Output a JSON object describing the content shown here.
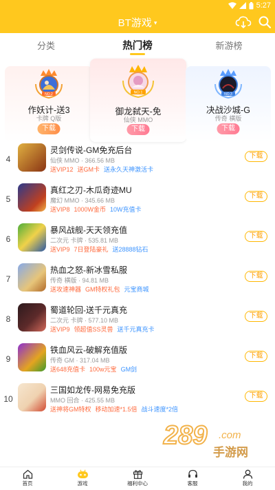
{
  "status_bar": {
    "time": "5:27"
  },
  "header": {
    "title": "BT游戏",
    "title_icon": "chevron-down-icon",
    "bg_color": "#ffc81e"
  },
  "tabs": [
    {
      "label": "分类",
      "active": false
    },
    {
      "label": "热门榜",
      "active": true
    },
    {
      "label": "新游榜",
      "active": false
    }
  ],
  "podium": [
    {
      "place": "left",
      "crown_label": "NO.2",
      "name": "作妖计-送3",
      "tag": "卡牌 Q版",
      "button": "下载",
      "crown_icon": "crown-icon"
    },
    {
      "place": "center",
      "crown_label": "NO.1",
      "name": "御龙弑天-免",
      "tag": "仙侠 MMO",
      "button": "下载",
      "crown_icon": "crown-icon"
    },
    {
      "place": "right",
      "crown_label": "NO.3",
      "name": "决战沙城-G",
      "tag": "传奇 横版",
      "button": "下载",
      "crown_icon": "crown-icon"
    }
  ],
  "games": [
    {
      "rank": "4",
      "name": "灵剑传说-GM免充后台",
      "meta": "仙侠 MMO · 366.56 MB",
      "tags": [
        {
          "text": "送VIP12",
          "color": "orange"
        },
        {
          "text": "送GM卡",
          "color": "orange"
        },
        {
          "text": "送永久天神激活卡",
          "color": "blue"
        }
      ],
      "button": "下载",
      "thumb_colors": [
        "#c98f28",
        "#7a2d12"
      ]
    },
    {
      "rank": "5",
      "name": "真红之刃-木瓜奇迹MU",
      "meta": "魔幻 MMO · 345.66 MB",
      "tags": [
        {
          "text": "送VIP8",
          "color": "orange"
        },
        {
          "text": "1000W金币",
          "color": "orange"
        },
        {
          "text": "10W充值卡",
          "color": "blue"
        }
      ],
      "button": "下载",
      "thumb_colors": [
        "#2f3d8a",
        "#b83a1f"
      ]
    },
    {
      "rank": "6",
      "name": "暴风战舰-天天领充值",
      "meta": "二次元 卡牌 · 535.81 MB",
      "tags": [
        {
          "text": "送VIP9",
          "color": "orange"
        },
        {
          "text": "7日登陆豪礼",
          "color": "orange"
        },
        {
          "text": "送28888钻石",
          "color": "blue"
        }
      ],
      "button": "下载",
      "thumb_colors": [
        "#49a63a",
        "#2b5aa8"
      ]
    },
    {
      "rank": "7",
      "name": "热血之怒-新冰雪私服",
      "meta": "传奇 横版 · 94.81 MB",
      "tags": [
        {
          "text": "送攻速神器",
          "color": "orange"
        },
        {
          "text": "GM特权礼包",
          "color": "orange"
        },
        {
          "text": "元宝商城",
          "color": "blue"
        }
      ],
      "button": "下载",
      "thumb_colors": [
        "#6b8fd9",
        "#d8b46a"
      ]
    },
    {
      "rank": "8",
      "name": "蜀道轮回-送千元真充",
      "meta": "二次元 卡牌 · 577.10 MB",
      "tags": [
        {
          "text": "送VIP9",
          "color": "orange"
        },
        {
          "text": "领超值SS灵兽",
          "color": "orange"
        },
        {
          "text": "送千元真充卡",
          "color": "blue"
        }
      ],
      "button": "下载",
      "thumb_colors": [
        "#3a1f22",
        "#c2574a"
      ]
    },
    {
      "rank": "9",
      "name": "铁血风云-破解充值版",
      "meta": "传奇 GM · 317.04 MB",
      "tags": [
        {
          "text": "送648充值卡",
          "color": "orange"
        },
        {
          "text": "100w元宝",
          "color": "orange"
        },
        {
          "text": "GM剑",
          "color": "blue"
        }
      ],
      "button": "下载",
      "thumb_colors": [
        "#8c2cc9",
        "#e3a21f"
      ]
    },
    {
      "rank": "10",
      "name": "三国如龙传-网易免充版",
      "meta": "MMO 回合 · 425.55 MB",
      "tags": [
        {
          "text": "送神将GM特权",
          "color": "orange"
        },
        {
          "text": "移动加速*1.5倍",
          "color": "orange"
        },
        {
          "text": "战斗速度*2倍",
          "color": "blue"
        }
      ],
      "button": "下载",
      "thumb_colors": [
        "#f3e0c8",
        "#d04a34"
      ]
    }
  ],
  "watermark": {
    "top": "289",
    "bottom": "手游网",
    "suffix": ".com"
  },
  "bottom_nav": [
    {
      "label": "首页",
      "icon": "home-icon",
      "active": false
    },
    {
      "label": "游戏",
      "icon": "game-controller-icon",
      "active": true
    },
    {
      "label": "福利中心",
      "icon": "gift-icon",
      "active": false
    },
    {
      "label": "客服",
      "icon": "headset-icon",
      "active": false
    },
    {
      "label": "我的",
      "icon": "user-icon",
      "active": false
    }
  ]
}
